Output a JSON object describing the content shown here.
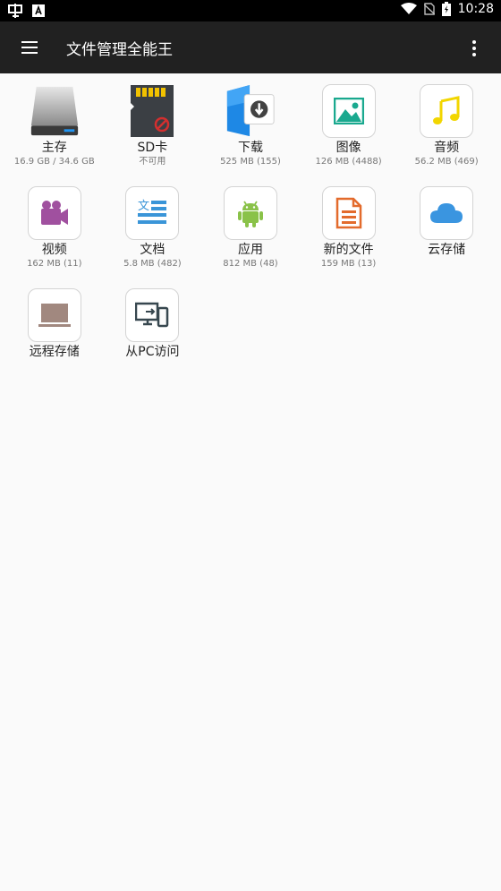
{
  "status_bar": {
    "time": "10:28",
    "icons": [
      "app-notification-icon",
      "a-notification-icon",
      "wifi-icon",
      "no-sim-icon",
      "battery-charging-icon"
    ]
  },
  "app_bar": {
    "title": "文件管理全能王",
    "menu_icon": "hamburger-menu-icon",
    "more_icon": "more-vertical-icon"
  },
  "tiles": [
    {
      "label": "主存",
      "sub": "16.9 GB / 34.6 GB",
      "icon": "hard-drive-icon"
    },
    {
      "label": "SD卡",
      "sub": "不可用",
      "icon": "sd-card-icon"
    },
    {
      "label": "下载",
      "sub": "525 MB (155)",
      "icon": "download-folder-icon"
    },
    {
      "label": "图像",
      "sub": "126 MB (4488)",
      "icon": "image-icon"
    },
    {
      "label": "音频",
      "sub": "56.2 MB (469)",
      "icon": "music-note-icon"
    },
    {
      "label": "视频",
      "sub": "162 MB (11)",
      "icon": "video-camera-icon"
    },
    {
      "label": "文档",
      "sub": "5.8 MB (482)",
      "icon": "document-icon",
      "icon_text": "文"
    },
    {
      "label": "应用",
      "sub": "812 MB (48)",
      "icon": "android-icon"
    },
    {
      "label": "新的文件",
      "sub": "159 MB (13)",
      "icon": "new-file-icon"
    },
    {
      "label": "云存储",
      "sub": "",
      "icon": "cloud-icon"
    },
    {
      "label": "远程存储",
      "sub": "",
      "icon": "laptop-icon"
    },
    {
      "label": "从PC访问",
      "sub": "",
      "icon": "pc-phone-icon"
    }
  ],
  "colors": {
    "status_bar": "#000000",
    "app_bar": "#212121",
    "background": "#fafafa",
    "image_teal": "#1aa98f",
    "audio_yellow": "#f2d600",
    "video_purple": "#a0509f",
    "document_blue": "#3a95d8",
    "android_green": "#8ac249",
    "newfile_orange": "#e36b2c",
    "cloud_blue": "#3a95e0",
    "laptop_brown": "#a1887f",
    "pc_dark": "#37474f"
  }
}
